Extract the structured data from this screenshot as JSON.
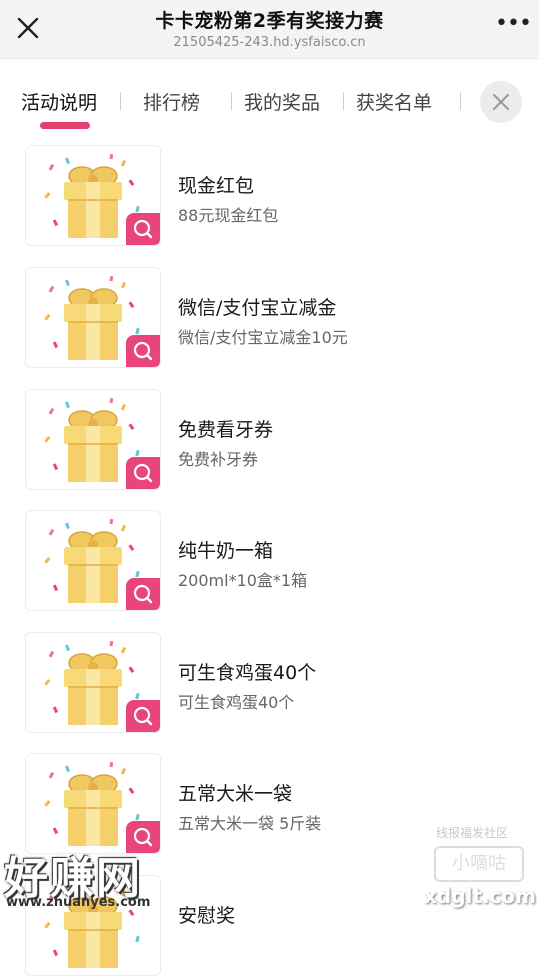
{
  "header": {
    "title": "卡卡宠粉第2季有奖接力赛",
    "url": "21505425-243.hd.ysfaisco.cn",
    "close_icon": "close-icon",
    "more_icon": "more-dots-icon",
    "more_label": "•••"
  },
  "tabs": [
    {
      "label": "活动说明",
      "active": true
    },
    {
      "label": "排行榜",
      "active": false
    },
    {
      "label": "我的奖品",
      "active": false
    },
    {
      "label": "获奖名单",
      "active": false
    }
  ],
  "colors": {
    "accent": "#e6416e",
    "badge": "#e8457a"
  },
  "prizes": [
    {
      "name": "现金红包",
      "desc": "88元现金红包"
    },
    {
      "name": "微信/支付宝立减金",
      "desc": "微信/支付宝立减金10元"
    },
    {
      "name": "免费看牙券",
      "desc": "免费补牙券"
    },
    {
      "name": "纯牛奶一箱",
      "desc": "200ml*10盒*1箱"
    },
    {
      "name": "可生食鸡蛋40个",
      "desc": "可生食鸡蛋40个"
    },
    {
      "name": "五常大米一袋",
      "desc": "五常大米一袋 5斤装"
    },
    {
      "name": "安慰奖",
      "desc": ""
    }
  ],
  "watermarks": {
    "left_big": "好赚网",
    "left_small": "www.zhuanyes.com",
    "right_top": "线报福发社区",
    "right_badge": "小嘀咕",
    "right_site": "xdglt.com"
  }
}
